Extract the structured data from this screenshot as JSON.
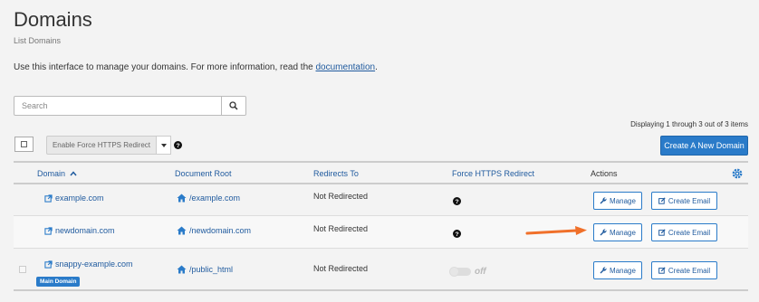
{
  "page": {
    "title": "Domains",
    "subtitle": "List Domains",
    "intro_text": "Use this interface to manage your domains. For more information, read the ",
    "intro_link": "documentation",
    "intro_end": "."
  },
  "search": {
    "placeholder": "Search",
    "value": ""
  },
  "toolbar": {
    "displaying": "Displaying 1 through 3 out of 3 items",
    "force_https_label": "Enable Force HTTPS Redirect",
    "create_label": "Create A New Domain"
  },
  "table": {
    "headers": {
      "domain": "Domain",
      "document_root": "Document Root",
      "redirects_to": "Redirects To",
      "force_https": "Force HTTPS Redirect",
      "actions": "Actions"
    },
    "rows": [
      {
        "domain": "example.com",
        "document_root": "/example.com",
        "redirects_to": "Not Redirected",
        "manage": "Manage",
        "create_email": "Create Email"
      },
      {
        "domain": "newdomain.com",
        "document_root": "/newdomain.com",
        "redirects_to": "Not Redirected",
        "manage": "Manage",
        "create_email": "Create Email"
      },
      {
        "domain": "snappy-example.com",
        "badge": "Main Domain",
        "document_root": "/public_html",
        "redirects_to": "Not Redirected",
        "force_https_state": "off",
        "manage": "Manage",
        "create_email": "Create Email"
      }
    ]
  },
  "icons": {
    "external_link": "external-link-icon",
    "home": "home-icon",
    "wrench": "wrench-icon",
    "edit": "edit-icon",
    "help": "help-icon",
    "gear": "gear-icon",
    "search": "search-icon",
    "sort": "sort-up-icon"
  },
  "colors": {
    "primary": "#2a7bc9",
    "link": "#1f5a9e",
    "annotation_arrow": "#f0702a"
  }
}
